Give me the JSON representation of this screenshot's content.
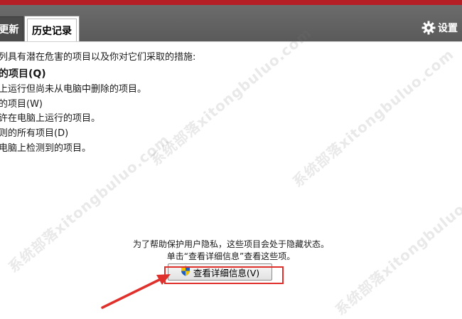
{
  "tabs": {
    "update_label": "更新",
    "history_label": "历史记录"
  },
  "settings_label": "设置",
  "content": {
    "intro": "列具有潜在危害的项目以及你对它们采取的措施:",
    "items": [
      {
        "title": "的项目(Q)",
        "desc": "上运行但尚未从电脑中删除的项目。"
      },
      {
        "title": "的项目(W)",
        "desc": "许在电脑上运行的项目。"
      },
      {
        "title": "则的所有项目(D)",
        "desc": "电脑上检测到的项目。"
      }
    ],
    "privacy_line1": "为了帮助保护用户隐私，这些项目会处于隐藏状态。",
    "privacy_line2": "单击“查看详细信息”查看这些项。",
    "details_button_label": "查看详细信息(V)"
  },
  "watermark_text": "系统部落xitongbuluo.com",
  "colors": {
    "header_bg": "#5f5f5f",
    "brand_red": "#b41e24",
    "highlight_red": "#e0302c",
    "shield_blue": "#1f5fbf",
    "shield_yellow": "#f2c200"
  },
  "icons": [
    "gear-icon",
    "shield-icon",
    "arrow-annotation"
  ]
}
